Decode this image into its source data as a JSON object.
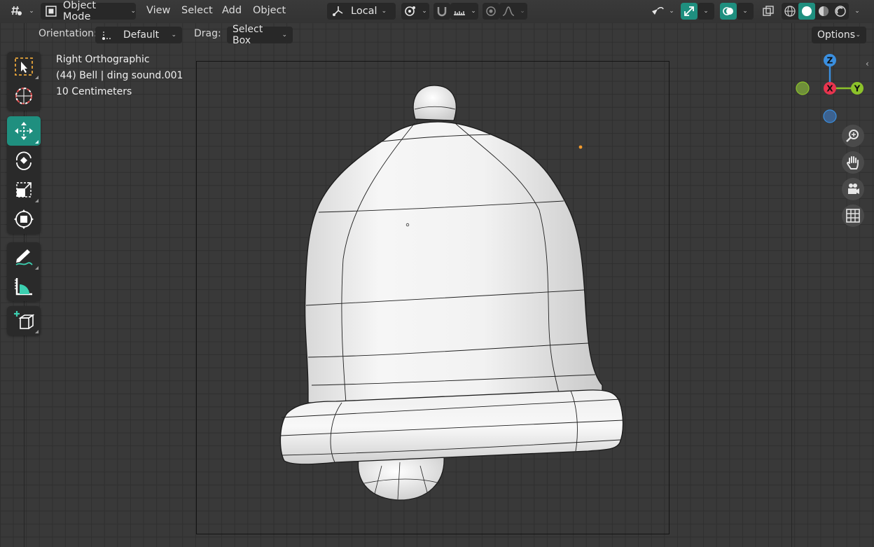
{
  "header": {
    "mode_label": "Object Mode",
    "menus": [
      "View",
      "Select",
      "Add",
      "Object"
    ],
    "transform_pivot": "Local",
    "options_label": "Options"
  },
  "toolbar_settings": {
    "orientation_label": "Orientation:",
    "orientation_value": "Default",
    "drag_label": "Drag:",
    "drag_value": "Select Box"
  },
  "viewport": {
    "view_name": "Right Orthographic",
    "object_info": "(44) Bell | ding sound.001",
    "scale_info": "10 Centimeters"
  },
  "gizmo": {
    "z_label": "Z",
    "x_label": "X",
    "y_label": "Y",
    "colors": {
      "x": "#e8344e",
      "y": "#8cc22a",
      "z": "#3a8fe0"
    }
  },
  "tools": [
    "select-box",
    "cursor",
    "move",
    "rotate",
    "scale",
    "transform",
    "annotate",
    "measure",
    "add-cube"
  ],
  "colors": {
    "accent": "#1f8f7f",
    "background": "#393939"
  }
}
